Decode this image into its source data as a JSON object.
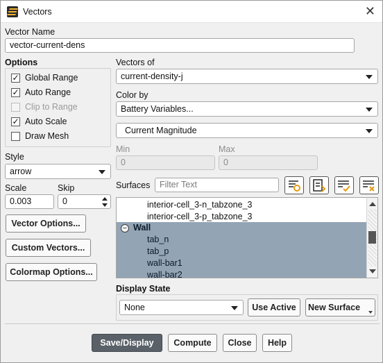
{
  "window": {
    "title": "Vectors",
    "close_glyph": "✕"
  },
  "vector_name": {
    "label": "Vector Name",
    "value": "vector-current-dens"
  },
  "options": {
    "label": "Options",
    "items": [
      {
        "label": "Global Range",
        "checked": true,
        "enabled": true
      },
      {
        "label": "Auto Range",
        "checked": true,
        "enabled": true
      },
      {
        "label": "Clip to Range",
        "checked": false,
        "enabled": false
      },
      {
        "label": "Auto Scale",
        "checked": true,
        "enabled": true
      },
      {
        "label": "Draw Mesh",
        "checked": false,
        "enabled": true
      }
    ]
  },
  "style": {
    "label": "Style",
    "value": "arrow"
  },
  "scale": {
    "label": "Scale",
    "value": "0.003"
  },
  "skip": {
    "label": "Skip",
    "value": "0"
  },
  "side_buttons": {
    "vector_options": "Vector Options...",
    "custom_vectors": "Custom Vectors...",
    "colormap_options": "Colormap Options..."
  },
  "vectors_of": {
    "label": "Vectors of",
    "value": "current-density-j"
  },
  "color_by": {
    "label": "Color by",
    "category": "Battery Variables...",
    "quantity": "Current Magnitude"
  },
  "range": {
    "min_label": "Min",
    "min_value": "0",
    "max_label": "Max",
    "max_value": "0"
  },
  "surfaces": {
    "label": "Surfaces",
    "filter_placeholder": "Filter Text",
    "icons": [
      "select-all-icon",
      "filter-list-icon",
      "check-all-icon",
      "clear-selection-icon"
    ],
    "items": [
      {
        "text": "interior-cell_3-n_tabzone_3",
        "selected": false,
        "group": false
      },
      {
        "text": "interior-cell_3-p_tabzone_3",
        "selected": false,
        "group": false
      },
      {
        "text": "Wall",
        "selected": true,
        "group": true
      },
      {
        "text": "tab_n",
        "selected": true,
        "group": false
      },
      {
        "text": "tab_p",
        "selected": true,
        "group": false
      },
      {
        "text": "wall-bar1",
        "selected": true,
        "group": false
      },
      {
        "text": "wall-bar2",
        "selected": true,
        "group": false
      }
    ]
  },
  "display_state": {
    "label": "Display State",
    "value": "None",
    "use_active": "Use Active",
    "new_surface": "New Surface"
  },
  "footer": {
    "save_display": "Save/Display",
    "compute": "Compute",
    "close": "Close",
    "help": "Help"
  }
}
